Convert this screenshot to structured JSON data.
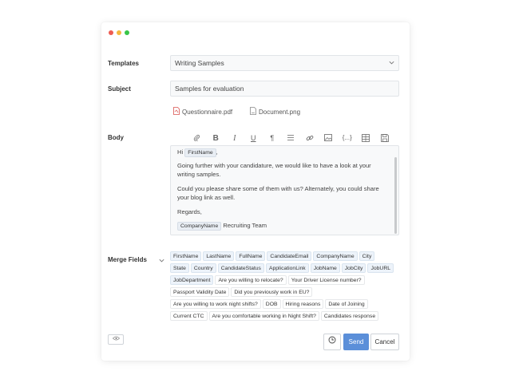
{
  "window": {
    "dots": [
      "#ee5c52",
      "#f5b83d",
      "#39c548"
    ]
  },
  "form": {
    "templates_label": "Templates",
    "templates_value": "Writing Samples",
    "subject_label": "Subject",
    "subject_value": "Samples for evaluation",
    "attachments": [
      "Questionnaire.pdf",
      "Document.png"
    ],
    "body_label": "Body",
    "merge_fields_label": "Merge Fields"
  },
  "toolbar_icons": [
    "paperclip-icon",
    "bold-icon",
    "italic-icon",
    "underline-icon",
    "paragraph-icon",
    "list-icon",
    "link-icon",
    "image-icon",
    "code-icon",
    "table-icon",
    "save-icon"
  ],
  "editor": {
    "greeting": "Hi",
    "first_name_chip": "FirstName",
    "greeting_comma": ",",
    "para1": "Going further with your candidature, we would like to have a look at your writing samples.",
    "para2": "Could you please share some of them with us? Alternately, you could share your blog link as well.",
    "regards": "Regards,",
    "company_chip": "CompanyName",
    "signature": "Recruiting Team"
  },
  "merge_fields": [
    [
      "FirstName",
      "LastName",
      "FullName",
      "CandidateEmail",
      "CompanyName",
      "City"
    ],
    [
      "State",
      "Country",
      "CandidateStatus",
      "ApplicationLink",
      "JobName",
      "JobCity",
      "JobURL"
    ],
    [
      "JobDepartment",
      "Are you willing to relocate?",
      "Your Driver License number?"
    ],
    [
      "Passport Validity Date",
      "Did you previously work in EU?"
    ],
    [
      "Are you willing to work night shifts?",
      "DOB",
      "Hiring reasons",
      "Date of Joining"
    ],
    [
      "Current CTC",
      "Are you comfortable working in Night Shift?",
      "Candidates response"
    ]
  ],
  "actions": {
    "send": "Send",
    "cancel": "Cancel"
  },
  "colors": {
    "accent": "#5b8fd9"
  }
}
